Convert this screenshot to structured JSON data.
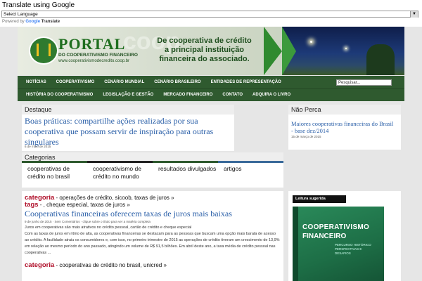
{
  "translate": {
    "title": "Translate using Google",
    "select_value": "Select Language",
    "powered_prefix": "Powered by",
    "powered_google": "Google",
    "powered_suffix": "Translate"
  },
  "header": {
    "brand": "PORTAL",
    "subtitle": "DO COOPERATIVISMO FINANCEIRO",
    "url": "www.cooperativismodecredito.coop.br",
    "watermark": "coop",
    "slogan": "De cooperativa de crédito a principal instituição financeira do associado."
  },
  "nav": {
    "row1": [
      "NOTÍCIAS",
      "COOPERATIVISMO",
      "CENÁRIO MUNDIAL",
      "CENÁRIO BRASILEIRO",
      "ENTIDADES DE REPRESENTAÇÃO"
    ],
    "row2": [
      "HISTÓRIA DO COOPERATIVISMO",
      "LEGISLAÇÃO E GESTÃO",
      "MERCADO FINANCEIRO",
      "CONTATO",
      "ADQUIRA O LIVRO"
    ],
    "search_value": "Pesquisar..."
  },
  "destaque": {
    "label": "Destaque",
    "headline": "Boas práticas: compartilhe ações realizadas por sua cooperativa que possam servir de inspiração para outras singulares",
    "date": "6 de maio de 2015"
  },
  "nao_perca": {
    "label": "Não Perca",
    "headline": "Maiores cooperativas financeiras do Brasil - base dez/2014",
    "date": "15 de março de 2015"
  },
  "categorias": {
    "label": "Categorias",
    "items": [
      "cooperativas de crédito no brasil",
      "cooperativismo de crédito no mundo",
      "resultados divulgados",
      "artigos"
    ],
    "colors": [
      "#2f5a2f",
      "#222222",
      "#2f5a2f",
      "#3a6a9a"
    ]
  },
  "article1": {
    "categoria_label": "categoria",
    "categoria_values": "- operações de crédito, sicoob, taxas de juros »",
    "tags_label": "tags",
    "tags_values": "- , cheque especial, taxas de juros »",
    "headline": "Cooperativas financeiras oferecem taxas de juros mais baixas",
    "meta": "9 de junho de 2015 · Sem Comentários · clique sobre o título para ver a matéria completa",
    "body1": "Juros em cooperativas são mais atrativos no crédito pessoal, cartão de crédito e cheque especial",
    "body2": "Com as taxas de juros em ritmo de alta, as cooperativas financeiras se destacam para as pessoas que buscam uma opção mais barata de acesso ao crédito. A facilidade atraiu os consumidores e, com isso, no primeiro trimestre de 2015 as operações de crédito tiveram um crescimento de 13,9% em relação ao mesmo período do ano passado, atingindo um volume de R$ 91,5 bilhões. Em abril deste ano, a taxa média de crédito pessoal nas cooperativas ..."
  },
  "article2": {
    "categoria_label": "categoria",
    "categoria_values": "- cooperativas de crédito no brasil, unicred »"
  },
  "sidebar": {
    "label": "Leitura sugerida",
    "book_title1": "COOPERATIVISMO",
    "book_title2": "FINANCEIRO",
    "book_sub": "PERCURSO HISTÓRICO PERSPECTIVAS E DESAFIOS"
  }
}
